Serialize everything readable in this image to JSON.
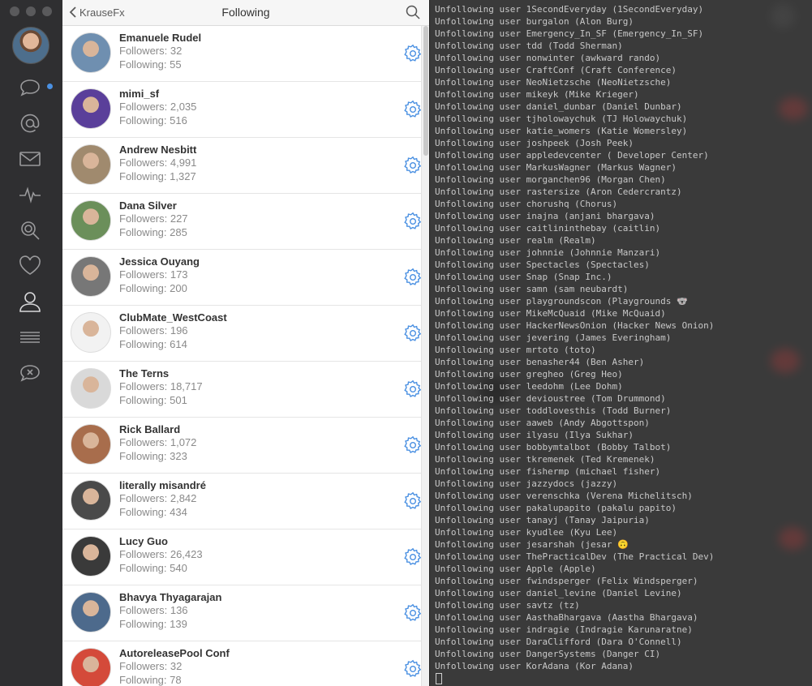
{
  "sidebar": {
    "icons": [
      "avatar",
      "messages-icon",
      "mentions-icon",
      "mail-icon",
      "activity-icon",
      "search-icon",
      "likes-icon",
      "profile-icon",
      "lists-icon",
      "mute-icon"
    ]
  },
  "header": {
    "back_label": "KrauseFx",
    "title": "Following"
  },
  "users": [
    {
      "name": "Emanuele Rudel",
      "followers": "Followers: 32",
      "following": "Following: 55",
      "color": "#6f8fb0"
    },
    {
      "name": "mimi_sf",
      "followers": "Followers: 2,035",
      "following": "Following: 516",
      "color": "#5a3f9a"
    },
    {
      "name": "Andrew Nesbitt",
      "followers": "Followers: 4,991",
      "following": "Following: 1,327",
      "color": "#a08a6e"
    },
    {
      "name": "Dana Silver",
      "followers": "Followers: 227",
      "following": "Following: 285",
      "color": "#6b8f5a"
    },
    {
      "name": "Jessica Ouyang",
      "followers": "Followers: 173",
      "following": "Following: 200",
      "color": "#777777"
    },
    {
      "name": "ClubMate_WestCoast",
      "followers": "Followers: 196",
      "following": "Following: 614",
      "color": "#f2f2f2"
    },
    {
      "name": "The Terns",
      "followers": "Followers: 18,717",
      "following": "Following: 501",
      "color": "#d9d9d9"
    },
    {
      "name": "Rick Ballard",
      "followers": "Followers: 1,072",
      "following": "Following: 323",
      "color": "#a86d4c"
    },
    {
      "name": "literally misandré",
      "followers": "Followers: 2,842",
      "following": "Following: 434",
      "color": "#4a4a4a"
    },
    {
      "name": "Lucy Guo",
      "followers": "Followers: 26,423",
      "following": "Following: 540",
      "color": "#3a3a3a"
    },
    {
      "name": "Bhavya Thyagarajan",
      "followers": "Followers: 136",
      "following": "Following: 139",
      "color": "#4d6a8c"
    },
    {
      "name": "AutoreleasePool Conf",
      "followers": "Followers: 32",
      "following": "Following: 78",
      "color": "#d44a3a"
    }
  ],
  "terminal": {
    "lines": [
      "Unfollowing user 1SecondEveryday (1SecondEveryday)",
      "Unfollowing user burgalon (Alon Burg)",
      "Unfollowing user Emergency_In_SF (Emergency_In_SF)",
      "Unfollowing user tdd (Todd Sherman)",
      "Unfollowing user nonwinter (awkward rando)",
      "Unfollowing user CraftConf (Craft Conference)",
      "Unfollowing user NeoNietzsche (NeoNietzsche)",
      "Unfollowing user mikeyk (Mike Krieger)",
      "Unfollowing user daniel_dunbar (Daniel Dunbar)",
      "Unfollowing user tjholowaychuk (TJ Holowaychuk)",
      "Unfollowing user katie_womers (Katie Womersley)",
      "Unfollowing user joshpeek (Josh Peek)",
      "Unfollowing user appledevcenter ( Developer Center)",
      "Unfollowing user MarkusWagner (Markus Wagner)",
      "Unfollowing user morganchen96 (Morgan Chen)",
      "Unfollowing user rastersize (Aron Cedercrantz)",
      "Unfollowing user chorushq (Chorus)",
      "Unfollowing user inajna (anjani bhargava)",
      "Unfollowing user caitlininthebay (caitlin)",
      "Unfollowing user realm (Realm)",
      "Unfollowing user johnnie (Johnnie Manzari)",
      "Unfollowing user Spectacles (Spectacles)",
      "Unfollowing user Snap (Snap Inc.)",
      "Unfollowing user samn (sam neubardt)",
      "Unfollowing user playgroundscon (Playgrounds 🐨",
      "Unfollowing user MikeMcQuaid (Mike McQuaid)",
      "Unfollowing user HackerNewsOnion (Hacker News Onion)",
      "Unfollowing user jevering (James Everingham)",
      "Unfollowing user mrtoto (toto)",
      "Unfollowing user benasher44 (Ben Asher)",
      "Unfollowing user gregheo (Greg Heo)",
      "Unfollowing user leedohm (Lee Dohm)",
      "Unfollowing user devioustree (Tom Drummond)",
      "Unfollowing user toddlovesthis (Todd Burner)",
      "Unfollowing user aaweb (Andy Abgottspon)",
      "Unfollowing user ilyasu (Ilya Sukhar)",
      "Unfollowing user bobbymtalbot (Bobby Talbot)",
      "Unfollowing user tkremenek (Ted Kremenek)",
      "Unfollowing user fishermp (michael fisher)",
      "Unfollowing user jazzydocs (jazzy)",
      "Unfollowing user verenschka (Verena Michelitsch)",
      "Unfollowing user pakalupapito (pakalu papito)",
      "Unfollowing user tanayj (Tanay Jaipuria)",
      "Unfollowing user kyudlee (Kyu Lee)",
      "Unfollowing user jesarshah (jesar 🙃",
      "Unfollowing user ThePracticalDev (The Practical Dev)",
      "Unfollowing user Apple (Apple)",
      "Unfollowing user fwindsperger (Felix Windsperger)",
      "Unfollowing user daniel_levine (Daniel Levine)",
      "Unfollowing user savtz (tz)",
      "Unfollowing user AasthaBhargava (Aastha Bhargava)",
      "Unfollowing user indragie (Indragie Karunaratne)",
      "Unfollowing user DaraClifford (Dara O'Connell)",
      "Unfollowing user DangerSystems (Danger CI)",
      "Unfollowing user KorAdana (Kor Adana)"
    ]
  },
  "colors": {
    "accent": "#4a90e2",
    "sidebar_bg": "#2f2f31",
    "terminal_bg": "#3a3a3a",
    "terminal_text": "#c8c8c8"
  }
}
